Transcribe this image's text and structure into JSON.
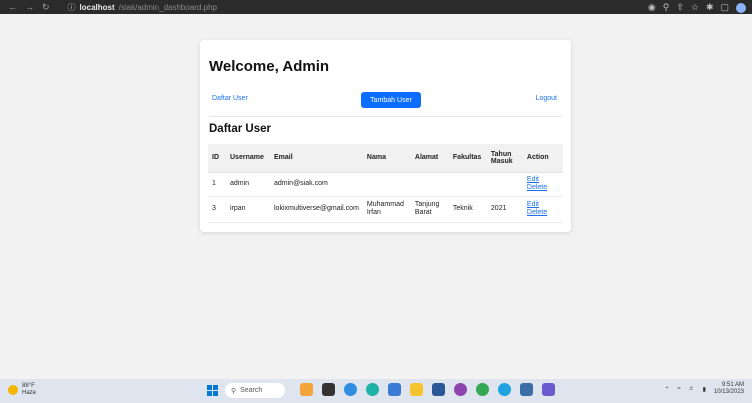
{
  "browser": {
    "url_host": "localhost",
    "url_path": "/siak/admin_dashboard.php"
  },
  "page": {
    "welcome": "Welcome, Admin",
    "links": {
      "daftar_user": "Daftar User",
      "tambah_user": "Tambah User",
      "logout": "Logout"
    },
    "section_title": "Daftar User",
    "table": {
      "headers": [
        "ID",
        "Username",
        "Email",
        "Nama",
        "Alamat",
        "Fakultas",
        "Tahun Masuk",
        "Action"
      ],
      "rows": [
        {
          "id": "1",
          "username": "admin",
          "email": "admin@siak.com",
          "nama": "",
          "alamat": "",
          "fakultas": "",
          "tahun": "",
          "edit": "Edit",
          "delete": "Delete"
        },
        {
          "id": "3",
          "username": "irpan",
          "email": "lokixmultiverse@gmail.com",
          "nama": "Muhammad Irfan",
          "alamat": "Tanjung Barat",
          "fakultas": "Teknik",
          "tahun": "2021",
          "edit": "Edit",
          "delete": "Delete"
        }
      ]
    }
  },
  "taskbar": {
    "weather_temp": "88°F",
    "weather_desc": "Haze",
    "search_label": "Search",
    "time": "9:51 AM",
    "date": "10/13/2023"
  },
  "colors": {
    "primary_button": "#0d6efd",
    "link": "#1a73e8"
  }
}
